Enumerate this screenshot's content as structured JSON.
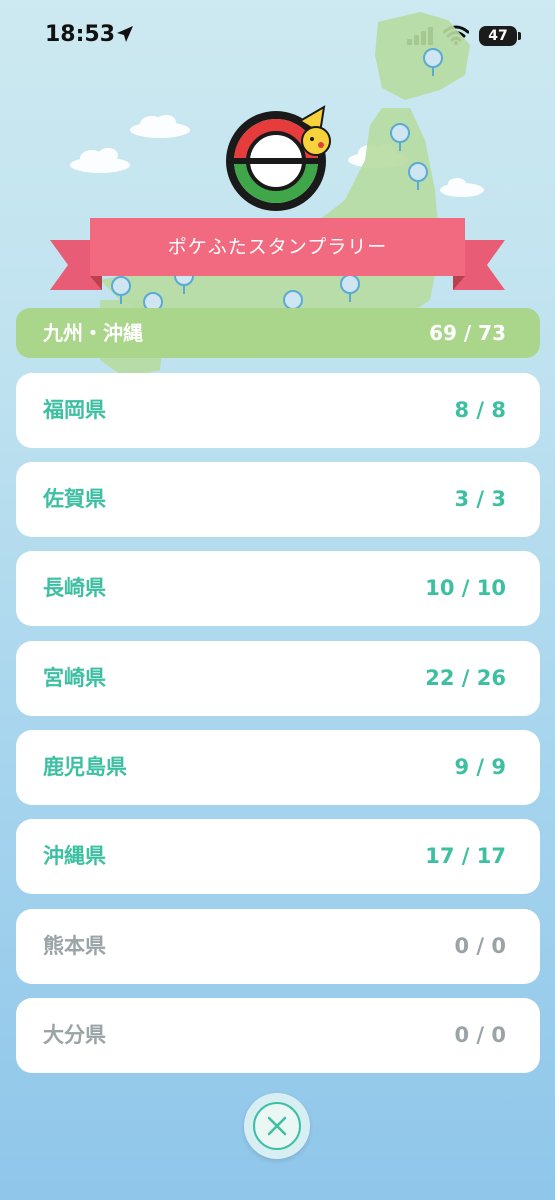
{
  "status_bar": {
    "time": "18:53",
    "battery": "47"
  },
  "banner": {
    "title": "ポケふたスタンプラリー"
  },
  "region": {
    "name": "九州・沖縄",
    "count": "69 / 73"
  },
  "prefectures": [
    {
      "name": "福岡県",
      "count": "8 / 8"
    },
    {
      "name": "佐賀県",
      "count": "3 / 3"
    },
    {
      "name": "長崎県",
      "count": "10 / 10"
    },
    {
      "name": "宮崎県",
      "count": "22 / 26"
    },
    {
      "name": "鹿児島県",
      "count": "9 / 9"
    },
    {
      "name": "沖縄県",
      "count": "17 / 17"
    },
    {
      "name": "熊本県",
      "count": "0 / 0"
    },
    {
      "name": "大分県",
      "count": "0 / 0"
    }
  ],
  "colors": {
    "accent": "#3dbfa2",
    "region_header": "#a9d68a",
    "banner": "#f0607a",
    "muted": "#9aa3a6"
  },
  "icons": [
    "location-arrow-icon",
    "signal-icon",
    "wifi-icon",
    "battery-icon",
    "map-pin-icon",
    "close-icon"
  ]
}
